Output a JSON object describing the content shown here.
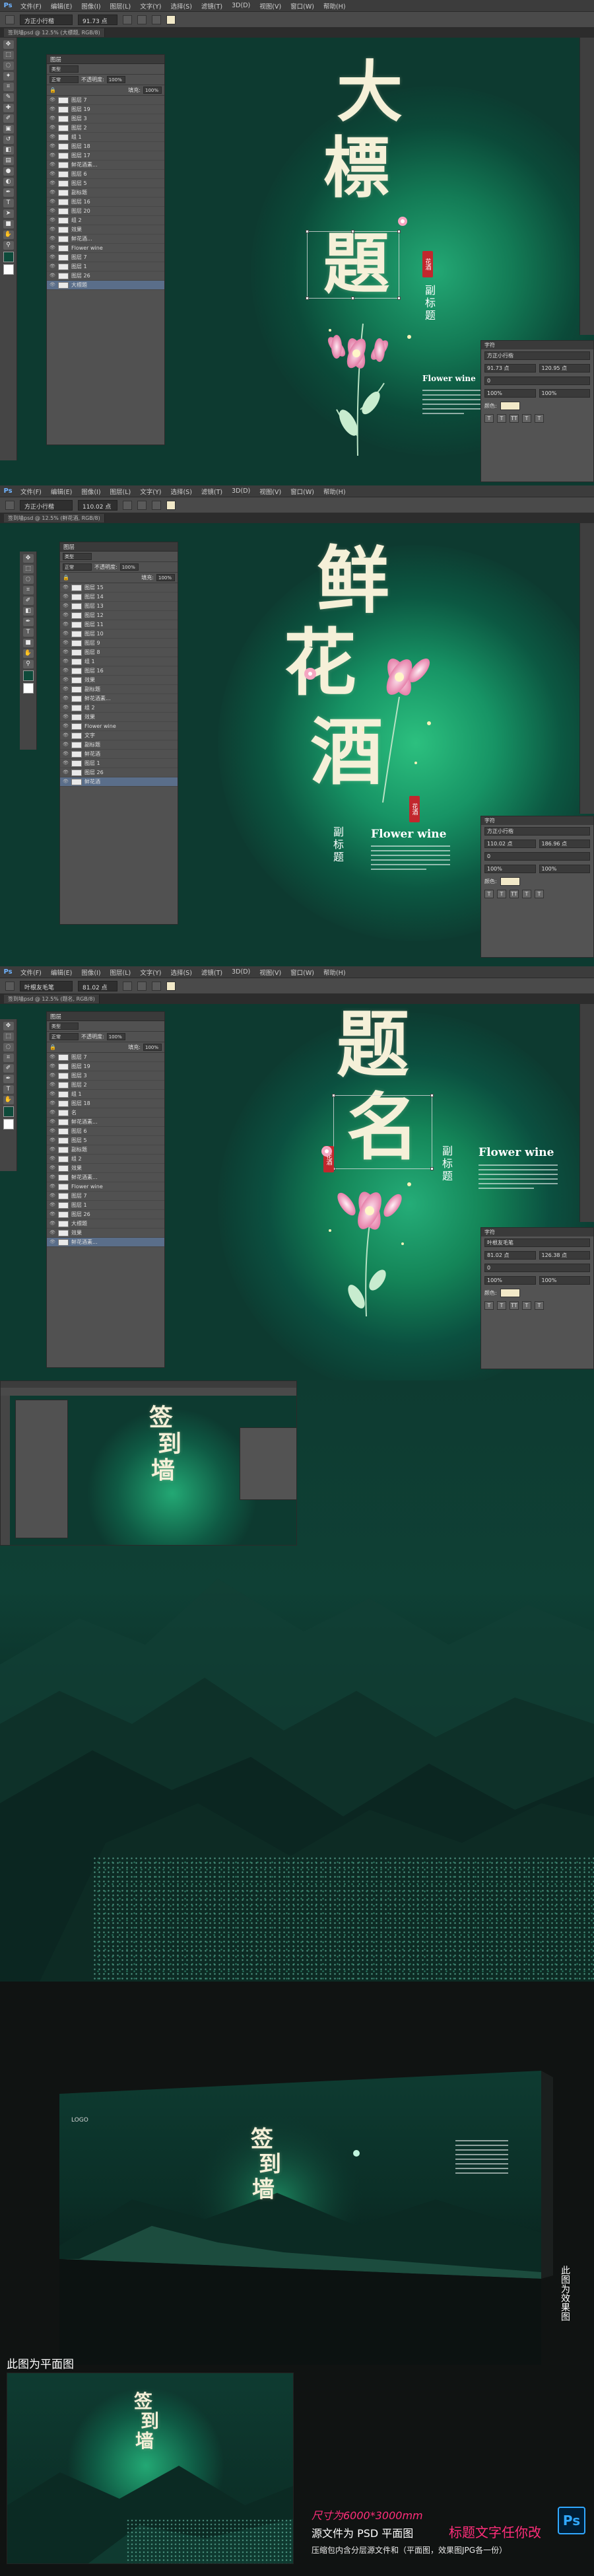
{
  "ps_ui": {
    "logo": "Ps",
    "menus": [
      "文件(F)",
      "编辑(E)",
      "图像(I)",
      "图层(L)",
      "文字(Y)",
      "选择(S)",
      "滤镜(T)",
      "3D(D)",
      "视图(V)",
      "窗口(W)",
      "帮助(H)"
    ],
    "screens": [
      {
        "font_field": "方正小行楷",
        "size_field": "91.73 点",
        "doc_tab": "签到墙psd @ 12.5% (大標題, RGB/8)",
        "layers_title": "图层",
        "kind_label": "类型",
        "blend": "正常",
        "opacity_label": "不透明度:",
        "opacity": "100%",
        "fill_label": "填充:",
        "fill": "100%",
        "layers": [
          "图层 7",
          "图层 19",
          "图层 3",
          "图层 2",
          "组 1",
          "图层 18",
          "图层 17",
          "鲜花酒素...",
          "图层 6",
          "图层 5",
          "副标题",
          "图层 16",
          "图层 20",
          "组 2",
          "效果",
          "鲜花酒...",
          "Flower wine",
          "图层 7",
          "图层 1",
          "图层 26",
          "大標題"
        ],
        "canvas": {
          "title_chars": [
            "大",
            "標",
            "題"
          ],
          "subtitle": [
            "副",
            "标",
            "题"
          ],
          "seal": "花酒",
          "english": "Flower wine"
        },
        "char_panel": {
          "title": "字符",
          "font": "方正小行楷",
          "size": "91.73 点",
          "leading": "120.95 点",
          "tracking": "0",
          "scale_v": "100%",
          "scale_h": "100%",
          "color_label": "颜色:"
        }
      },
      {
        "font_field": "方正小行楷",
        "size_field": "110.02 点",
        "doc_tab": "签到墙psd @ 12.5% (鲜花酒, RGB/8)",
        "layers_title": "图层",
        "kind_label": "类型",
        "blend": "正常",
        "opacity_label": "不透明度:",
        "opacity": "100%",
        "fill_label": "填充:",
        "fill": "100%",
        "layers": [
          "图层 15",
          "图层 14",
          "图层 13",
          "图层 12",
          "图层 11",
          "图层 10",
          "图层 9",
          "图层 8",
          "组 1",
          "图层 16",
          "效果",
          "副标题",
          "鲜花酒素...",
          "组 2",
          "效果",
          "Flower wine",
          "文字",
          "副标题",
          "鲜花酒",
          "图层 1",
          "图层 26",
          "鲜花酒"
        ],
        "canvas": {
          "title_chars": [
            "鲜",
            "花",
            "酒"
          ],
          "subtitle": [
            "副",
            "标",
            "题"
          ],
          "seal": "花酒",
          "english": "Flower wine"
        },
        "char_panel": {
          "title": "字符",
          "font": "方正小行楷",
          "size": "110.02 点",
          "leading": "186.96 点",
          "tracking": "0",
          "scale_v": "100%",
          "scale_h": "100%",
          "color_label": "颜色:"
        }
      },
      {
        "font_field": "叶根友毛笔",
        "size_field": "81.02 点",
        "doc_tab": "签到墙psd @ 12.5% (题名, RGB/8)",
        "layers_title": "图层",
        "kind_label": "类型",
        "blend": "正常",
        "opacity_label": "不透明度:",
        "opacity": "100%",
        "fill_label": "填充:",
        "fill": "100%",
        "layers": [
          "图层 7",
          "图层 19",
          "图层 3",
          "图层 2",
          "组 1",
          "图层 18",
          "名",
          "鲜花酒素...",
          "图层 6",
          "图层 5",
          "副标题",
          "组 2",
          "效果",
          "鲜花酒素...",
          "Flower wine",
          "图层 7",
          "图层 1",
          "图层 26",
          "大標題",
          "效果",
          "鲜花酒素..."
        ],
        "canvas": {
          "title_chars": [
            "题",
            "名"
          ],
          "subtitle": [
            "副",
            "标",
            "题"
          ],
          "seal": "花酒",
          "english": "Flower wine"
        },
        "char_panel": {
          "title": "字符",
          "font": "叶根友毛笔",
          "size": "81.02 点",
          "leading": "126.38 点",
          "tracking": "0",
          "scale_v": "100%",
          "scale_h": "100%",
          "color_label": "颜色:"
        }
      }
    ]
  },
  "section4": {
    "thumb_title": [
      "签",
      "到",
      "墙"
    ]
  },
  "mockup": {
    "logo": "LOGO",
    "title": [
      "签",
      "到",
      "墙"
    ],
    "side_note": "此图为效果图",
    "flat_label": "此图为平面图",
    "thumb_title": [
      "签",
      "到",
      "墙"
    ]
  },
  "promo": {
    "size": "尺寸为6000*3000mm",
    "source_prefix": "源文件为 PSD 平面图",
    "editable": "标题文字任你改",
    "pack": "压缩包内含分层源文件和（平面图，效果图JPG各一份）",
    "ps_badge": "Ps"
  },
  "colors": {
    "bg_dark": "#0d3a30",
    "glow": "#1fa36f",
    "ps_panel": "#535353",
    "promo_pink": "#ff2d7a",
    "seal_red": "#c2272d"
  }
}
